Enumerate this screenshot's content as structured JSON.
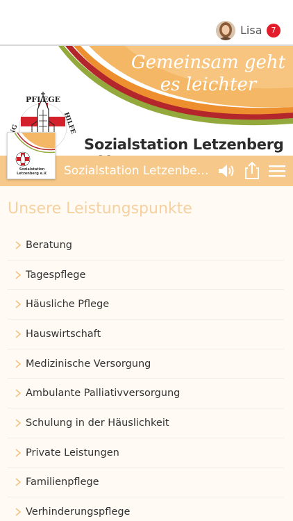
{
  "header": {
    "user_name": "Lisa",
    "notification_count": "7"
  },
  "banner": {
    "slogan_line1": "Gemeinsam geht",
    "slogan_line2": "es leichter",
    "logo_text_top": "PFLEGE",
    "logo_text_right": "HILFE",
    "logo_text_left": "NG",
    "station_name": "Sozialstation Letzenberg e.V."
  },
  "thumbnail": {
    "label": "Sozialstation Letzenberg e.V."
  },
  "navbar": {
    "title": "Sozialstation Letzenberg e.V.",
    "icons": [
      "speaker-icon",
      "share-icon",
      "menu-icon"
    ]
  },
  "main": {
    "heading": "Unsere Leistungspunkte",
    "items": [
      {
        "label": "Beratung"
      },
      {
        "label": "Tagespflege"
      },
      {
        "label": "Häusliche Pflege"
      },
      {
        "label": "Hauswirtschaft"
      },
      {
        "label": "Medizinische Versorgung"
      },
      {
        "label": "Ambulante Palliativversorgung"
      },
      {
        "label": "Schulung in der Häuslichkeit"
      },
      {
        "label": "Private Leistungen"
      },
      {
        "label": "Familienpflege"
      },
      {
        "label": "Verhinderungspflege"
      }
    ]
  },
  "colors": {
    "accent": "#f6c98b",
    "badge": "#e21c2a",
    "heading": "#f5d1a0",
    "chevron": "#f2c27e",
    "banner_orange": "#f4b766",
    "banner_red": "#b3262b",
    "banner_green": "#93a93c"
  }
}
